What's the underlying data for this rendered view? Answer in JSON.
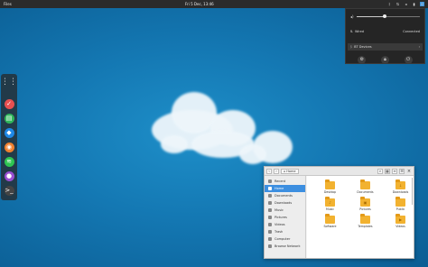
{
  "topbar": {
    "left_label": "Files",
    "clock": "Fri 5 Dec, 13:46",
    "tray_icons": [
      "bluetooth-icon",
      "network-icon",
      "volume-icon",
      "battery-icon",
      "power-icon"
    ]
  },
  "popover": {
    "volume_level": 0.45,
    "wifi_label": "Wired",
    "wifi_status": "Connected",
    "bt_label": "BT Devices",
    "bt_arrow": "›",
    "buttons": [
      "settings-icon",
      "lock-icon",
      "power-icon"
    ]
  },
  "dock": {
    "apps": [
      {
        "name": "app-grid-icon",
        "color": "#dddddd",
        "glyph": "⋮⋮"
      },
      {
        "name": "app-red-icon",
        "color": "#e85050",
        "glyph": "✓"
      },
      {
        "name": "app-green-icon",
        "color": "#2fb65a",
        "glyph": "▤"
      },
      {
        "name": "app-blue-icon",
        "color": "#1e88e5",
        "glyph": "◆"
      },
      {
        "name": "app-orange-icon",
        "color": "#f0812f",
        "glyph": "◉"
      },
      {
        "name": "app-spotify-icon",
        "color": "#2ec552",
        "glyph": "≋"
      },
      {
        "name": "app-purple-icon",
        "color": "#9a4fd1",
        "glyph": "●"
      },
      {
        "name": "app-terminal-icon",
        "color": "#444444",
        "glyph": ">_"
      }
    ]
  },
  "files": {
    "back": "‹",
    "forward": "›",
    "path_label": "Home",
    "sidebar": [
      "Recent",
      "Home",
      "Documents",
      "Downloads",
      "Music",
      "Pictures",
      "Videos",
      "Trash",
      "Computer",
      "Browse Network"
    ],
    "selected": 1,
    "folders": [
      {
        "name": "Desktop",
        "glyph": ""
      },
      {
        "name": "Documents",
        "glyph": ""
      },
      {
        "name": "Downloads",
        "glyph": "↓"
      },
      {
        "name": "Music",
        "glyph": "♪"
      },
      {
        "name": "Pictures",
        "glyph": "▣"
      },
      {
        "name": "Public",
        "glyph": ""
      },
      {
        "name": "Software",
        "glyph": ""
      },
      {
        "name": "Templates",
        "glyph": ""
      },
      {
        "name": "Videos",
        "glyph": "▶"
      }
    ],
    "close": "×"
  },
  "colors": {
    "accent": "#3d8fe0",
    "wallpaper": "#1478b3"
  }
}
